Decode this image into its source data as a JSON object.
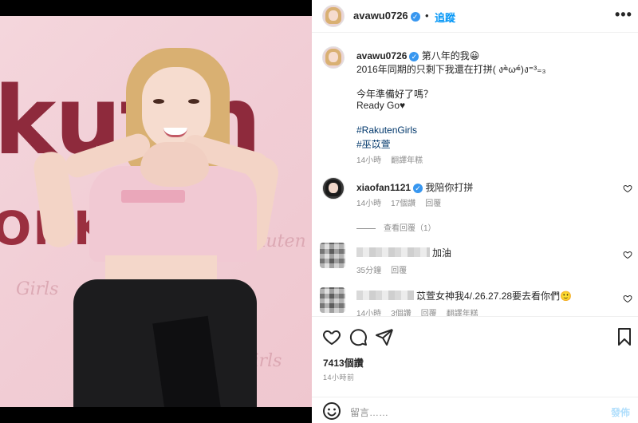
{
  "header": {
    "username": "avawu0726",
    "verified_mark": "✓",
    "separator": "•",
    "follow_label": "追蹤",
    "more_label": "•••"
  },
  "caption": {
    "username": "avawu0726",
    "line1": "第八年的我😀",
    "line2": "2016年同期的只剩下我還在打拼( ง⁼̴̀ω⁼̴́)ง⁼³₌₃",
    "line3": "今年準備好了嗎？",
    "line4": "Ready Go♥",
    "hashtag1": "#RakutenGirls",
    "hashtag2": "#巫苡萱",
    "meta_time": "14小時",
    "meta_translate": "翻譯年糕"
  },
  "comments": [
    {
      "username": "xiaofan1121",
      "text": "我陪你打拼",
      "time": "14小時",
      "likes": "17個讚",
      "reply": "回覆",
      "view_replies": "查看回覆（1）"
    },
    {
      "username": "",
      "text": "加油",
      "time": "35分鐘",
      "reply": "回覆"
    },
    {
      "username": "",
      "text": "苡萱女神我4/.26.27.28要去看你們🙂",
      "time": "14小時",
      "likes": "3個讚",
      "reply": "回覆",
      "translate": "翻譯年糕"
    }
  ],
  "stats": {
    "likes": "7413個讚",
    "posted": "14小時前"
  },
  "composer": {
    "placeholder": "留言……",
    "post_label": "發佈"
  },
  "icons": {
    "like": "heart-icon",
    "comment": "comment-icon",
    "share": "share-icon",
    "save": "bookmark-icon",
    "emoji": "emoji-icon",
    "options": "more-options-icon"
  },
  "colors": {
    "link_blue": "#0095f6",
    "verified_blue": "#3897f0",
    "hashtag": "#00376b",
    "muted": "#8e8e8e"
  }
}
